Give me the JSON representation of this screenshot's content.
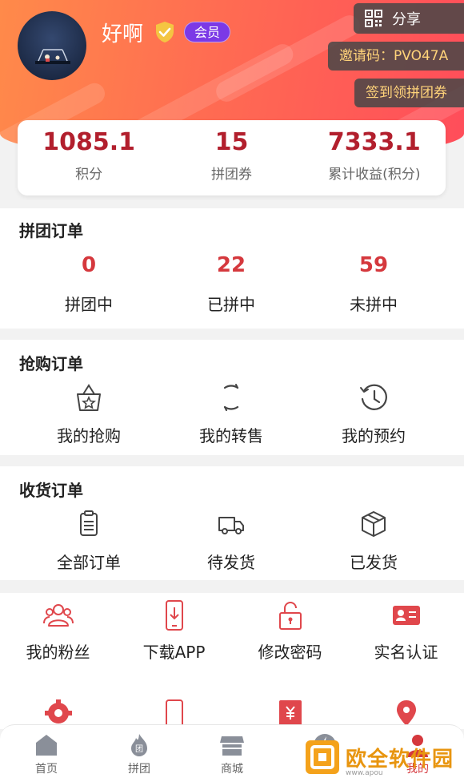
{
  "header": {
    "username": "好啊",
    "member_badge": "会员",
    "share_label": "分享",
    "invite_code": "邀请码：PVO47A",
    "signin_label": "签到领拼团券"
  },
  "stats": [
    {
      "value": "1085.1",
      "label": "积分"
    },
    {
      "value": "15",
      "label": "拼团券"
    },
    {
      "value": "7333.1",
      "label": "累计收益(积分)"
    }
  ],
  "group_orders": {
    "title": "拼团订单",
    "items": [
      {
        "count": "0",
        "label": "拼团中"
      },
      {
        "count": "22",
        "label": "已拼中"
      },
      {
        "count": "59",
        "label": "未拼中"
      }
    ]
  },
  "flash_orders": {
    "title": "抢购订单",
    "items": [
      {
        "label": "我的抢购",
        "icon": "shopping-bag-star-icon"
      },
      {
        "label": "我的转售",
        "icon": "refresh-icon"
      },
      {
        "label": "我的预约",
        "icon": "history-clock-icon"
      }
    ]
  },
  "delivery_orders": {
    "title": "收货订单",
    "items": [
      {
        "label": "全部订单",
        "icon": "clipboard-icon"
      },
      {
        "label": "待发货",
        "icon": "truck-icon"
      },
      {
        "label": "已发货",
        "icon": "package-icon"
      }
    ]
  },
  "tools": {
    "row1": [
      {
        "label": "我的粉丝",
        "icon": "fans-icon"
      },
      {
        "label": "下载APP",
        "icon": "download-phone-icon"
      },
      {
        "label": "修改密码",
        "icon": "lock-icon"
      },
      {
        "label": "实名认证",
        "icon": "id-card-icon"
      }
    ]
  },
  "tabbar": [
    {
      "label": "首页",
      "icon": "home-icon"
    },
    {
      "label": "拼团",
      "icon": "flame-icon"
    },
    {
      "label": "商城",
      "icon": "store-icon"
    },
    {
      "label": "",
      "icon": "lightning-icon"
    },
    {
      "label": "我的",
      "icon": "user-icon"
    }
  ],
  "watermark": {
    "text": "欧全软件园",
    "url": "www.apou"
  },
  "colors": {
    "accent_red": "#d5383d",
    "header_start": "#ff8a4a",
    "header_end": "#ff4d5a",
    "badge_purple": "#7b39e6",
    "gold": "#ffd37a"
  }
}
